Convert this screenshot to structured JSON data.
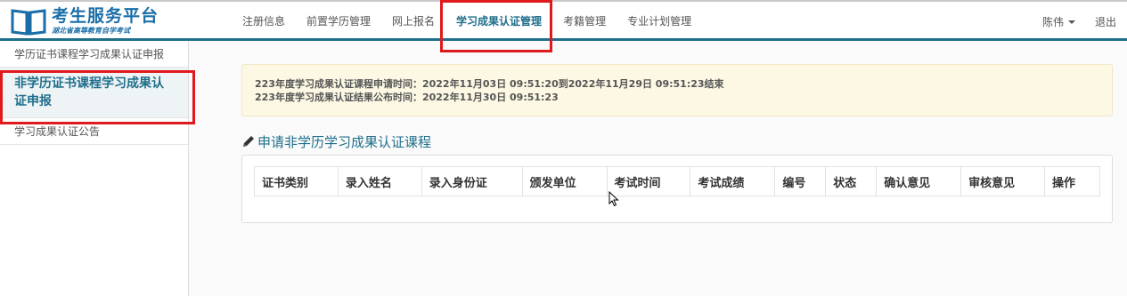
{
  "header": {
    "logo_title": "考生服务平台",
    "logo_subtitle": "湖北省高等教育自学考试",
    "nav": [
      {
        "label": "注册信息"
      },
      {
        "label": "前置学历管理"
      },
      {
        "label": "网上报名"
      },
      {
        "label": "学习成果认证管理"
      },
      {
        "label": "考籍管理"
      },
      {
        "label": "专业计划管理"
      }
    ],
    "user_name": "陈伟",
    "logout_label": "退出"
  },
  "sidebar": {
    "items": [
      {
        "label": "学历证书课程学习成果认证申报"
      },
      {
        "label": "非学历证书课程学习成果认证申报"
      },
      {
        "label": "学习成果认证公告"
      }
    ]
  },
  "notice": {
    "line1": "223年度学习成果认证课程申请时间：2022年11月03日 09:51:20到2022年11月29日 09:51:23结束",
    "line2": "223年度学习成果认证结果公布时间：2022年11月30日 09:51:23"
  },
  "section": {
    "title": "申请非学历学习成果认证课程"
  },
  "table": {
    "headers": [
      "证书类别",
      "录入姓名",
      "录入身份证",
      "颁发单位",
      "考试时间",
      "考试成绩",
      "编号",
      "状态",
      "确认意见",
      "审核意见",
      "操作"
    ]
  },
  "colors": {
    "accent": "#1f6f8b",
    "highlight": "#e0191c",
    "notice_bg": "#fcf8e3"
  }
}
